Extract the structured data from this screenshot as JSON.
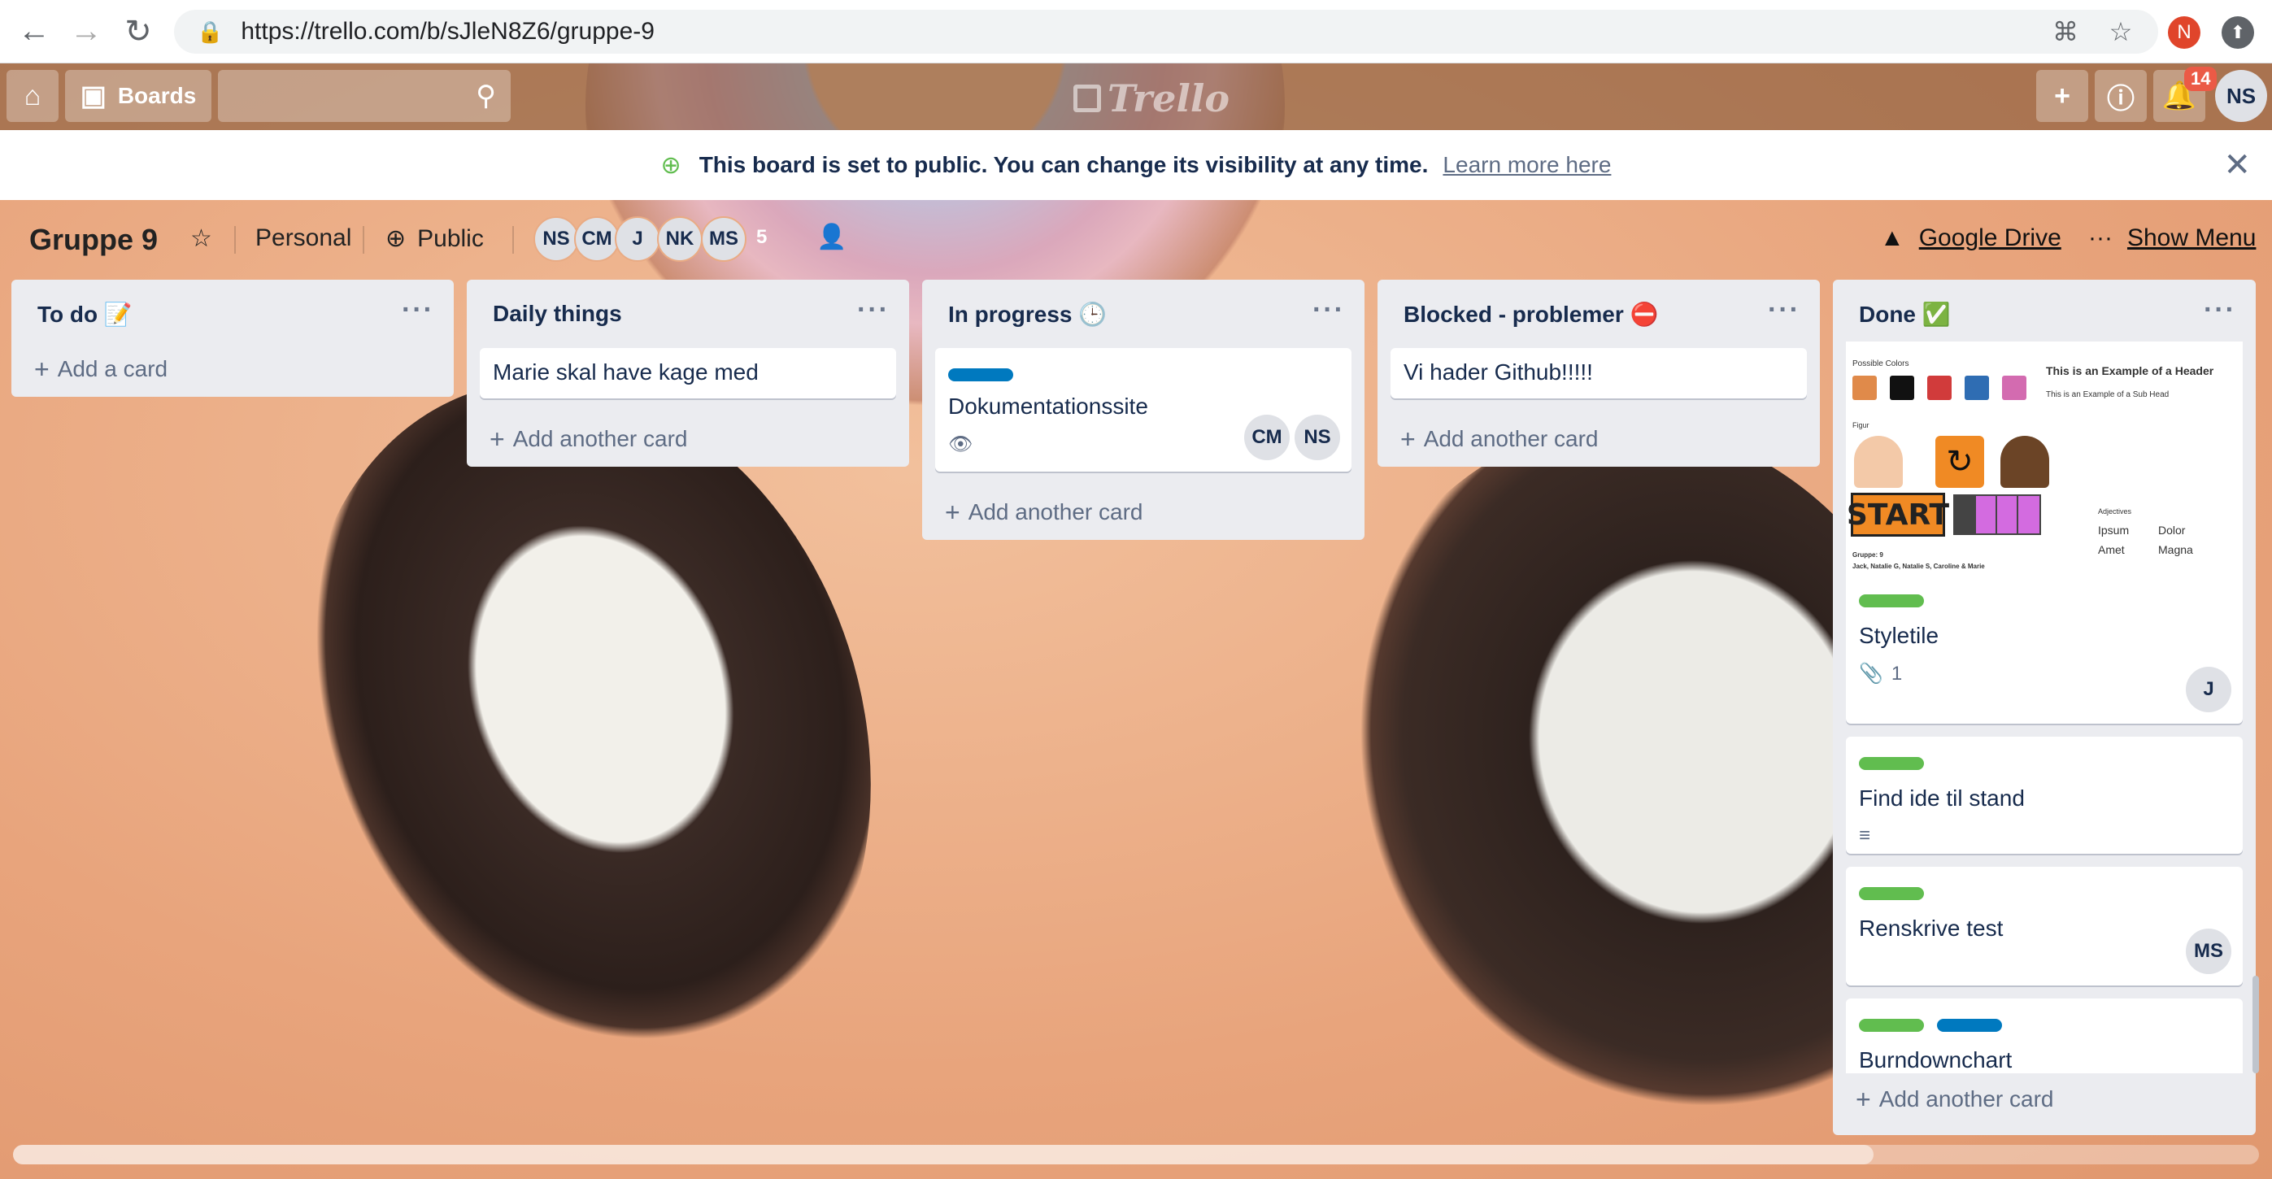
{
  "browser": {
    "url": "https://trello.com/b/sJleN8Z6/gruppe-9",
    "profile_initial": "N"
  },
  "header": {
    "boards_label": "Boards",
    "logo_text": "Trello",
    "notification_count": "14",
    "user_initials": "NS"
  },
  "banner": {
    "message": "This board is set to public. You can change its visibility at any time.",
    "link": "Learn more here"
  },
  "board": {
    "title": "Gruppe 9",
    "team": "Personal",
    "visibility": "Public",
    "members": [
      "NS",
      "CM",
      "J",
      "NK",
      "MS"
    ],
    "member_count": "5",
    "drive_label": "Google Drive",
    "menu_label": "Show Menu"
  },
  "lists": [
    {
      "title": "To do 📝",
      "add_label": "Add a card"
    },
    {
      "title": "Daily things",
      "cards": [
        {
          "title": "Marie skal have kage med"
        }
      ],
      "add_label": "Add another card"
    },
    {
      "title": "In progress 🕒",
      "cards": [
        {
          "title": "Dokumentationssite",
          "members": [
            "CM",
            "NS"
          ]
        }
      ],
      "add_label": "Add another card"
    },
    {
      "title": "Blocked - problemer ⛔",
      "cards": [
        {
          "title": "Vi hader Github!!!!!"
        }
      ],
      "add_label": "Add another card"
    },
    {
      "title": "Done ✅",
      "cards": [
        {
          "title": "Styletile",
          "attachments": "1",
          "members": [
            "J"
          ]
        },
        {
          "title": "Find ide til stand"
        },
        {
          "title": "Renskrive test",
          "members": [
            "MS"
          ]
        },
        {
          "title": "Burndownchart"
        }
      ],
      "add_label": "Add another card"
    }
  ],
  "styletile_preview": {
    "possible_colors": "Possible Colors",
    "header": "This is an Example of a Header",
    "subhead": "This is an Example of a Sub Head",
    "figur": "Figur",
    "start": "START",
    "adjectives": "Adjectives",
    "adj_words": [
      "Ipsum",
      "Dolor",
      "Amet",
      "Magna"
    ],
    "group": "Gruppe: 9",
    "group_members": "Jack, Natalie G, Natalie S, Caroline & Marie",
    "colors": [
      "#e08a4a",
      "#111111",
      "#d13b3b",
      "#2f6db3",
      "#d36bb0"
    ]
  },
  "colors": {
    "label_green": "#61bd4f",
    "label_blue": "#0079bf",
    "notification_badge": "#eb5a46"
  }
}
